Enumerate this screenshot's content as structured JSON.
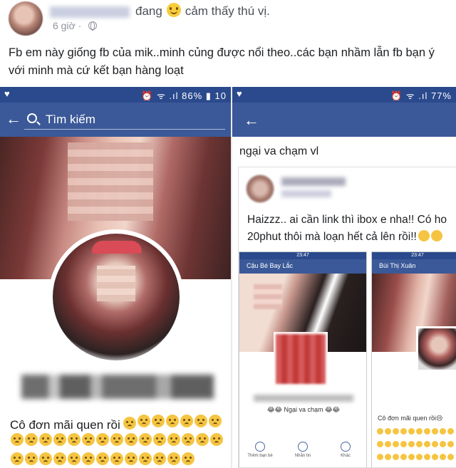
{
  "post": {
    "status_word": "đang",
    "feeling": "cảm thấy thú vị.",
    "time": "6 giờ",
    "separator": "·",
    "body": "Fb em này giống fb của mik..minh củng được nổi theo..các bạn nhầm lẫn fb bạn ý với minh mà cứ kết bạn hàng loạt"
  },
  "left_phone": {
    "status_right": "⏰ ᯤ .ıl 86% ▮ 10",
    "search_placeholder": "Tìm kiếm",
    "bio": "Cô đơn mãi quen rồi"
  },
  "right_phone": {
    "status_right": "⏰ ᯤ .ıl 77%",
    "title": "ngại va chạm vl",
    "card_line1": "Haizzz.. ai cần link thì ibox e nha!! Có ho",
    "card_line2": "20phut thôi mà loạn hết cả lên rồi!!",
    "mini1": {
      "time": "23:47",
      "search": "Cậu Bé Bay Lắc",
      "caption": "😂😂 Ngại va chạm 😂😂",
      "actions": [
        "Thêm bạn bè",
        "Nhắn tin",
        "Khác"
      ]
    },
    "mini2": {
      "time": "23:47",
      "search": "Bùi Thị Xuân",
      "caption": "Cô đơn mãi quen rồi😢"
    }
  },
  "icons": {
    "status_heart": "heart-icon",
    "back": "back-arrow-icon",
    "search": "search-icon",
    "globe": "globe-icon",
    "feeling": "smile-icon"
  },
  "colors": {
    "fb_blue": "#3b5998",
    "status_blue": "#2b4a8d"
  }
}
